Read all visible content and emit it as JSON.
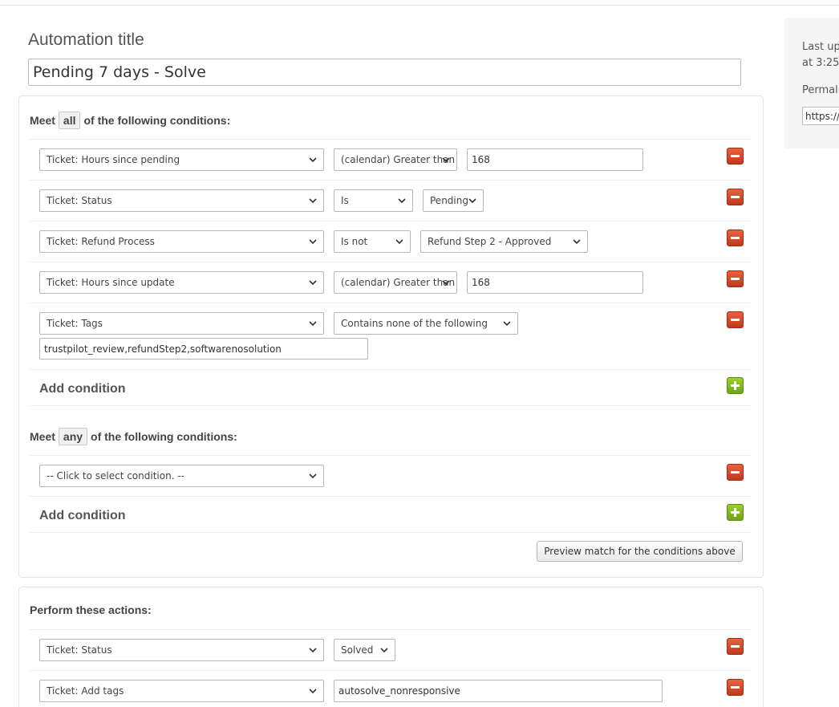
{
  "automation": {
    "title_label": "Automation title",
    "title_value": "Pending 7 days - Solve"
  },
  "conditions_all": {
    "meet_prefix": "Meet",
    "qualifier": "all",
    "meet_suffix": "of the following conditions:",
    "rows": [
      {
        "field": "Ticket: Hours since pending",
        "operator": "(calendar) Greater than",
        "value": "168"
      },
      {
        "field": "Ticket: Status",
        "operator": "Is",
        "value": "Pending"
      },
      {
        "field": "Ticket: Refund Process",
        "operator": "Is not",
        "value": "Refund Step 2 - Approved"
      },
      {
        "field": "Ticket: Hours since update",
        "operator": "(calendar) Greater than",
        "value": "168"
      },
      {
        "field": "Ticket: Tags",
        "operator": "Contains none of the following",
        "value": "trustpilot_review,refundStep2,softwarenosolution"
      }
    ],
    "add_label": "Add condition"
  },
  "conditions_any": {
    "meet_prefix": "Meet",
    "qualifier": "any",
    "meet_suffix": "of the following conditions:",
    "rows": [
      {
        "field": "-- Click to select condition. --"
      }
    ],
    "add_label": "Add condition"
  },
  "preview_button": "Preview match for the conditions above",
  "actions": {
    "title": "Perform these actions:",
    "rows": [
      {
        "field": "Ticket: Status",
        "value": "Solved"
      },
      {
        "field": "Ticket: Add tags",
        "value": "autosolve_nonresponsive"
      }
    ]
  },
  "sidebar": {
    "last_updated_line1": "Last upd",
    "last_updated_line2": "at 3:25",
    "permalink_label": "Permali",
    "permalink_value": "https://s"
  },
  "icons": {
    "remove": "minus-icon",
    "add": "plus-icon",
    "dropdown": "chevron-down-icon"
  },
  "colors": {
    "remove_button": "#d44a2a",
    "add_button": "#86bd22"
  }
}
